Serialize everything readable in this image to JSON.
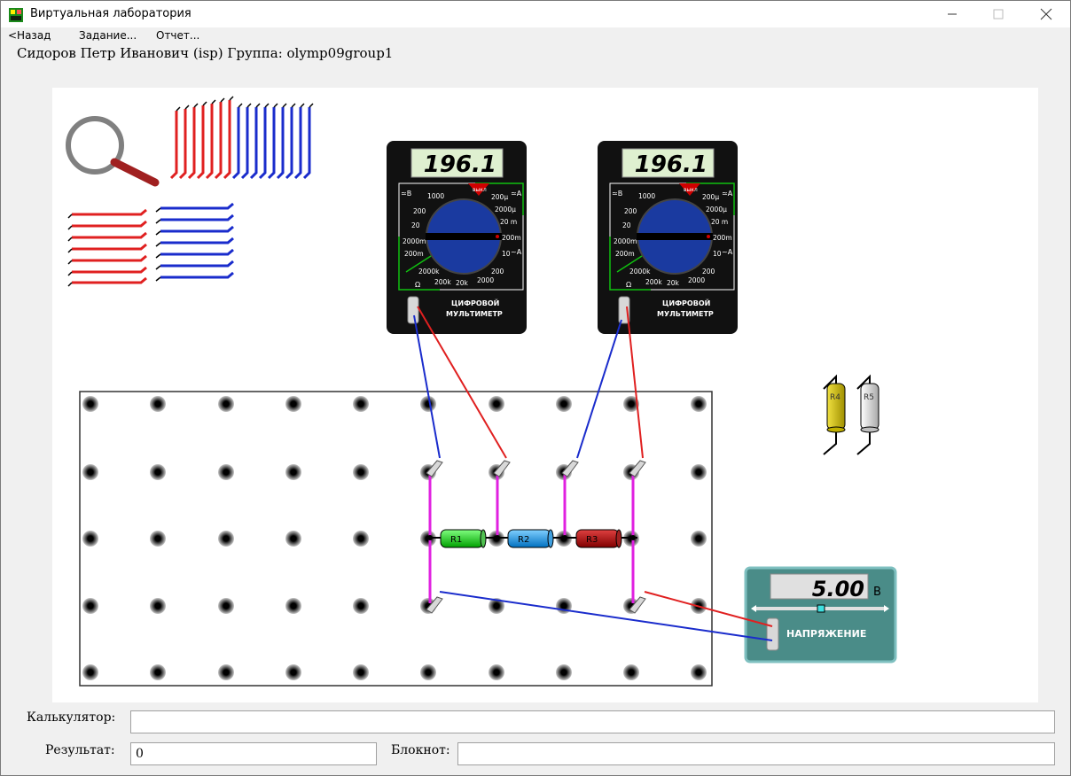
{
  "window": {
    "title": "Виртуальная лаборатория",
    "minimize_icon": "minimize-icon",
    "maximize_icon": "maximize-icon",
    "close_icon": "close-icon"
  },
  "menu": {
    "back": "<Назад",
    "task": "Задание...",
    "report": "Отчет..."
  },
  "student_line": "Сидоров Петр Иванович (isp)  Группа: olymp09group1",
  "meters": [
    {
      "display": "196.1",
      "label_line1": "ЦИФРОВОЙ",
      "label_line2": "МУЛЬТИМЕТР",
      "dial": {
        "off": "выкл",
        "v_dc": "≃B",
        "a_dc": "≃A",
        "a_ac": "~A",
        "ohm": "Ω",
        "left_scale": [
          "1000",
          "200",
          "20",
          "2000m",
          "200m"
        ],
        "right_scale": [
          "200µ",
          "2000µ",
          "20 m",
          "200m",
          "10"
        ],
        "bottom_scale": [
          "2000k",
          "200k",
          "20k",
          "2000",
          "200"
        ]
      }
    },
    {
      "display": "196.1",
      "label_line1": "ЦИФРОВОЙ",
      "label_line2": "МУЛЬТИМЕТР",
      "dial": {
        "off": "выкл",
        "v_dc": "≃B",
        "a_dc": "≃A",
        "a_ac": "~A",
        "ohm": "Ω",
        "left_scale": [
          "1000",
          "200",
          "20",
          "2000m",
          "200m"
        ],
        "right_scale": [
          "200µ",
          "2000µ",
          "20 m",
          "200m",
          "10"
        ],
        "bottom_scale": [
          "2000k",
          "200k",
          "20k",
          "2000",
          "200"
        ]
      }
    }
  ],
  "resistors": {
    "board": [
      "R1",
      "R2",
      "R3"
    ],
    "spare": [
      "R4",
      "R5"
    ],
    "colors": {
      "R1": "#00e000",
      "R2": "#1aa0e8",
      "R3": "#c00000",
      "R4": "#d4c400",
      "R5": "#d8d8d8"
    }
  },
  "power_supply": {
    "value": "5.00",
    "unit": "В",
    "label": "НАПРЯЖЕНИЕ"
  },
  "colors": {
    "wire_red": "#e02020",
    "wire_blue": "#1a2ccc",
    "jumper": "#e020e0",
    "meter_body": "#111111",
    "supply_body": "#4a8c88"
  },
  "tools": {
    "magnifier": "magnifier-icon",
    "wire_sets": [
      "red-vertical-wires",
      "blue-vertical-wires",
      "red-horizontal-wires",
      "blue-horizontal-wires"
    ]
  },
  "bottom": {
    "calculator_label": "Калькулятор:",
    "calculator_value": "",
    "result_label": "Результат:",
    "result_value": "0",
    "notepad_label": "Блокнот:",
    "notepad_value": ""
  }
}
